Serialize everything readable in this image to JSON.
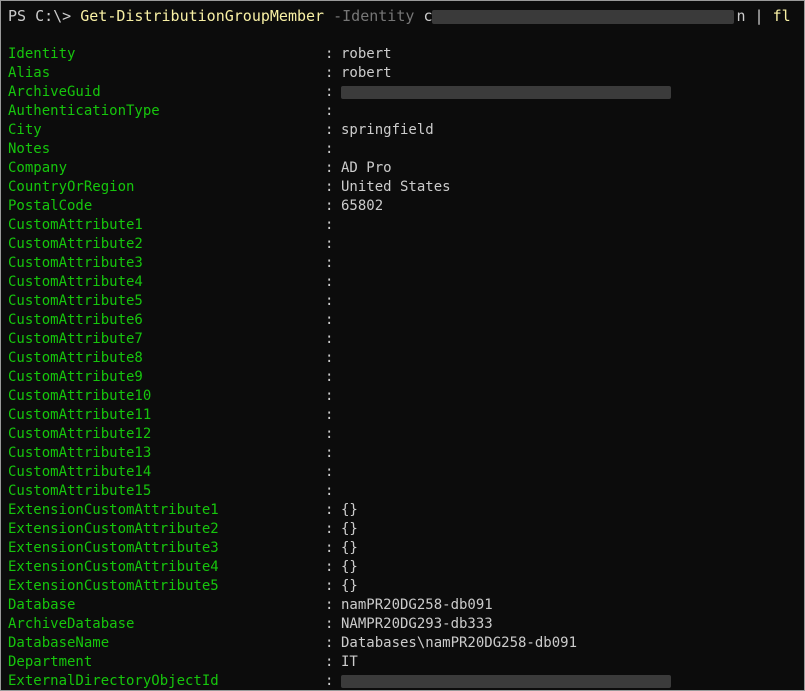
{
  "terminal": {
    "prompt": "PS C:\\>",
    "command": "Get-DistributionGroupMember",
    "parameter": "-Identity",
    "argument_visible": "c",
    "argument_tail": "n",
    "pipe": "|",
    "format_cmd": "fl",
    "separator": ":"
  },
  "properties": [
    {
      "key": "Identity",
      "value": "robert"
    },
    {
      "key": "Alias",
      "value": "robert"
    },
    {
      "key": "ArchiveGuid",
      "value": "",
      "redacted": true
    },
    {
      "key": "AuthenticationType",
      "value": ""
    },
    {
      "key": "City",
      "value": "springfield"
    },
    {
      "key": "Notes",
      "value": ""
    },
    {
      "key": "Company",
      "value": "AD Pro"
    },
    {
      "key": "CountryOrRegion",
      "value": "United States"
    },
    {
      "key": "PostalCode",
      "value": "65802"
    },
    {
      "key": "CustomAttribute1",
      "value": ""
    },
    {
      "key": "CustomAttribute2",
      "value": ""
    },
    {
      "key": "CustomAttribute3",
      "value": ""
    },
    {
      "key": "CustomAttribute4",
      "value": ""
    },
    {
      "key": "CustomAttribute5",
      "value": ""
    },
    {
      "key": "CustomAttribute6",
      "value": ""
    },
    {
      "key": "CustomAttribute7",
      "value": ""
    },
    {
      "key": "CustomAttribute8",
      "value": ""
    },
    {
      "key": "CustomAttribute9",
      "value": ""
    },
    {
      "key": "CustomAttribute10",
      "value": ""
    },
    {
      "key": "CustomAttribute11",
      "value": ""
    },
    {
      "key": "CustomAttribute12",
      "value": ""
    },
    {
      "key": "CustomAttribute13",
      "value": ""
    },
    {
      "key": "CustomAttribute14",
      "value": ""
    },
    {
      "key": "CustomAttribute15",
      "value": ""
    },
    {
      "key": "ExtensionCustomAttribute1",
      "value": "{}"
    },
    {
      "key": "ExtensionCustomAttribute2",
      "value": "{}"
    },
    {
      "key": "ExtensionCustomAttribute3",
      "value": "{}"
    },
    {
      "key": "ExtensionCustomAttribute4",
      "value": "{}"
    },
    {
      "key": "ExtensionCustomAttribute5",
      "value": "{}"
    },
    {
      "key": "Database",
      "value": "namPR20DG258-db091"
    },
    {
      "key": "ArchiveDatabase",
      "value": "NAMPR20DG293-db333"
    },
    {
      "key": "DatabaseName",
      "value": "Databases\\namPR20DG258-db091"
    },
    {
      "key": "Department",
      "value": "IT"
    },
    {
      "key": "ExternalDirectoryObjectId",
      "value": "",
      "redacted": true
    }
  ],
  "colors": {
    "background": "#0c0c0c",
    "property_name": "#16c60c",
    "text": "#cccccc",
    "cmdlet": "#f9f1a5",
    "parameter": "#767676",
    "redaction": "#3a3a3a"
  }
}
